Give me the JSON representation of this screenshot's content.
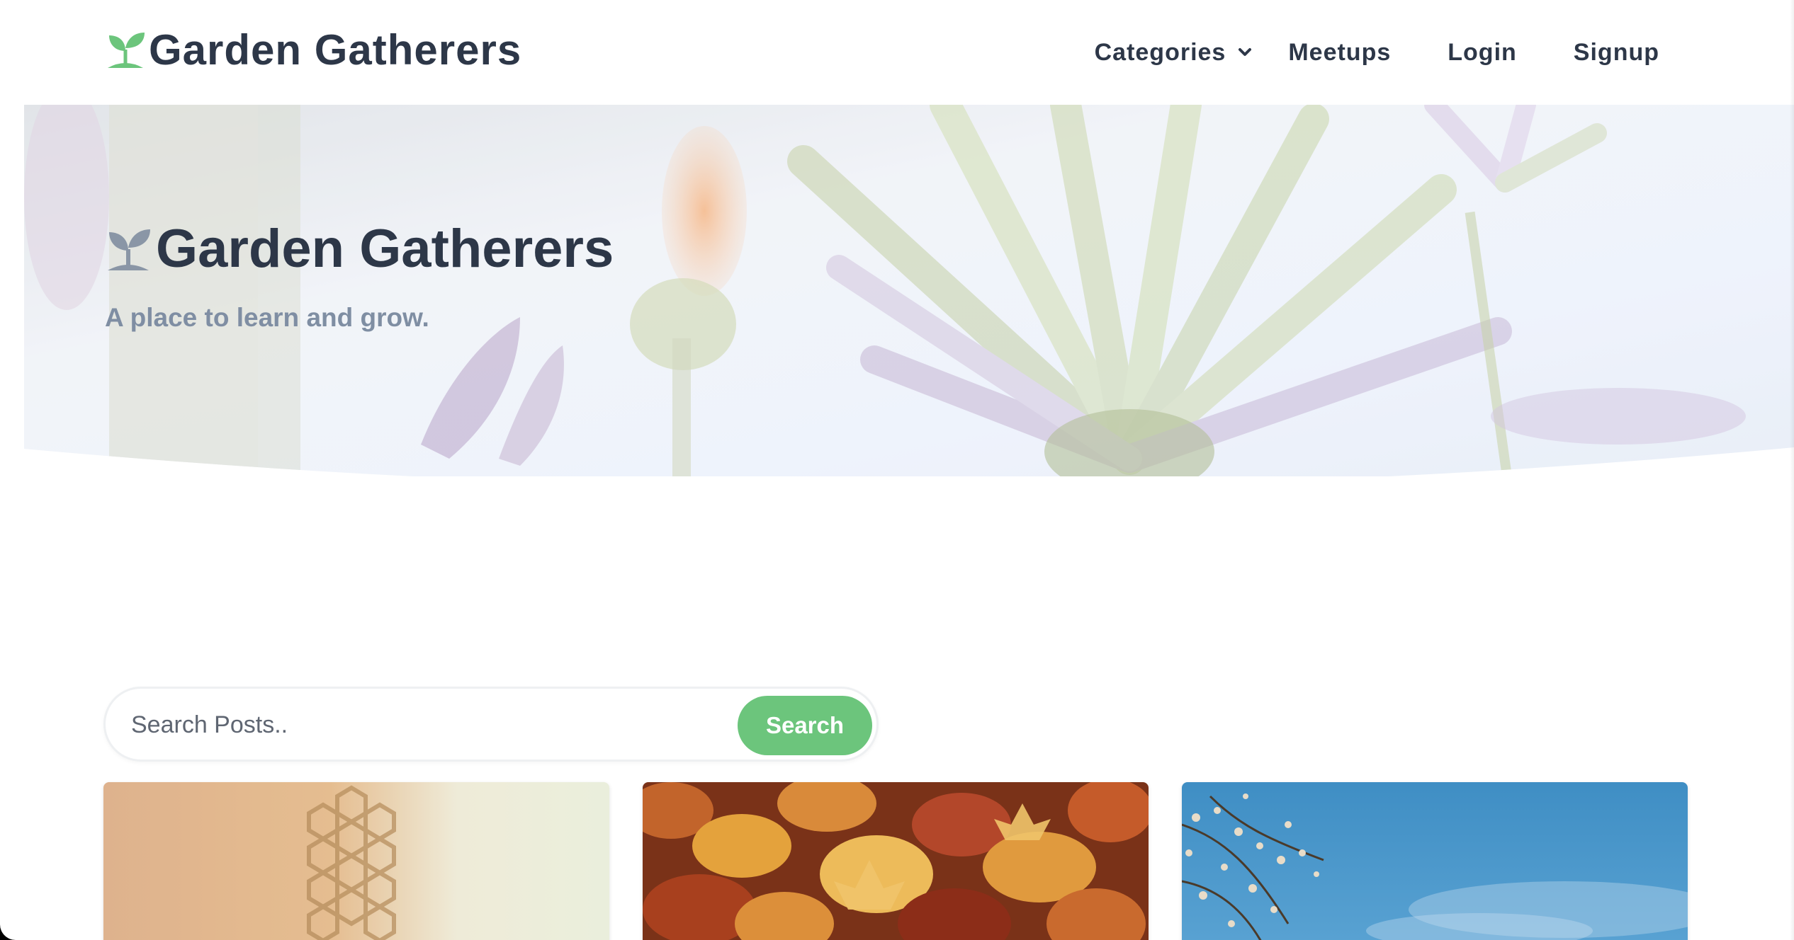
{
  "brand": {
    "name": "Garden Gatherers",
    "icon": "seedling-icon",
    "icon_color": "#6cc57c"
  },
  "nav": {
    "categories_label": "Categories",
    "meetups_label": "Meetups",
    "login_label": "Login",
    "signup_label": "Signup"
  },
  "hero": {
    "title": "Garden Gatherers",
    "subtitle": "A place to learn and grow.",
    "icon": "seedling-icon"
  },
  "search": {
    "placeholder": "Search Posts..",
    "value": "",
    "button_label": "Search"
  },
  "colors": {
    "accent": "#6cc57c",
    "text_dark": "#2d3748",
    "text_muted": "#7f8ea3"
  },
  "cards": [
    {
      "image": "honeycomb-photo"
    },
    {
      "image": "autumn-leaves-photo"
    },
    {
      "image": "blossom-branch-sky-photo"
    }
  ]
}
